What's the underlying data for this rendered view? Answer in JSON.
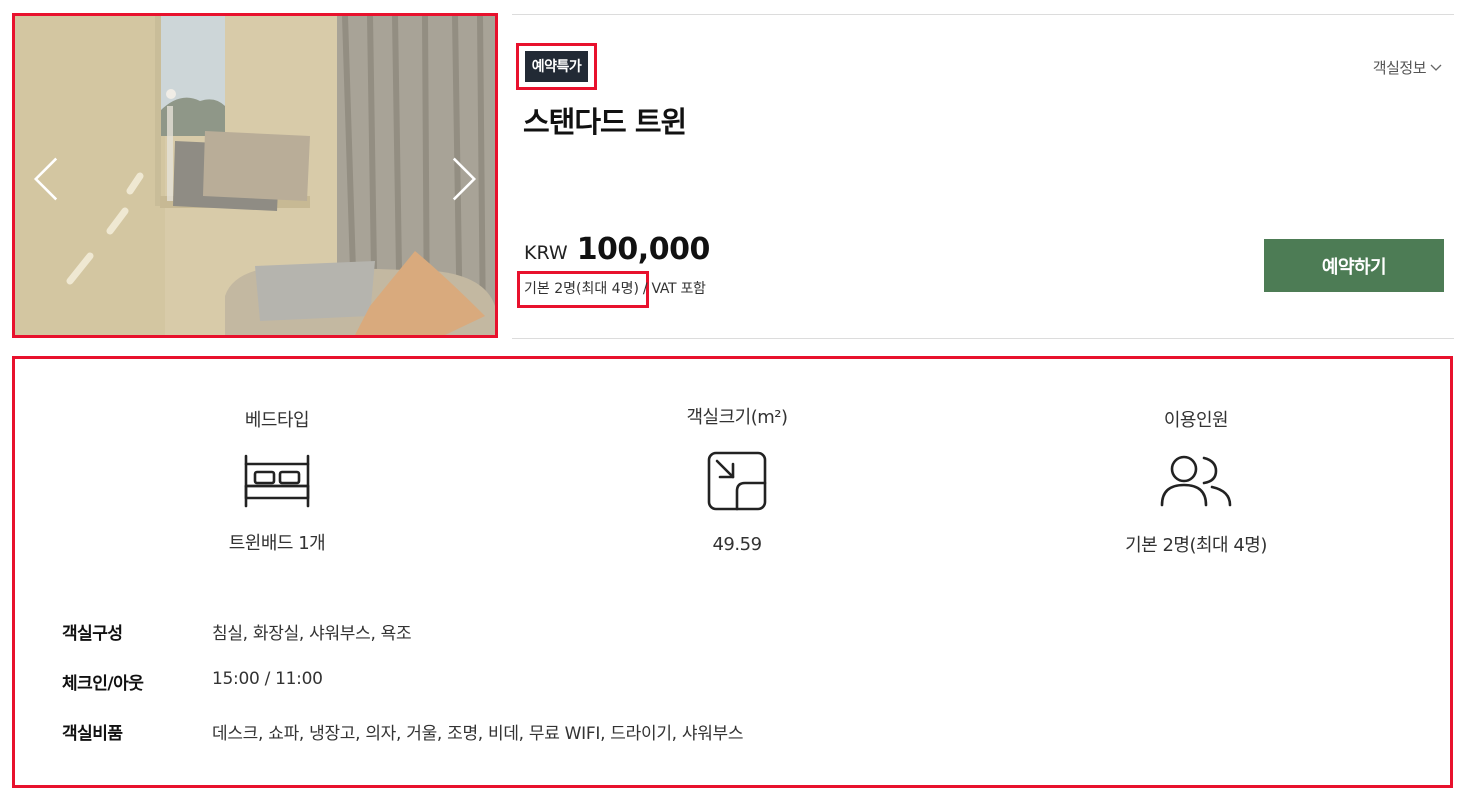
{
  "room": {
    "badge": "예약특가",
    "title": "스탠다드 트윈",
    "info_toggle": "객실정보",
    "currency": "KRW",
    "price": "100,000",
    "occupancy": "기본 2명(최대 4명)",
    "vat": "/ VAT 포함",
    "reserve_label": "예약하기"
  },
  "features": {
    "bed": {
      "label": "베드타입",
      "value": "트윈배드 1개",
      "icon": "bed-icon"
    },
    "size": {
      "label": "객실크기(m²)",
      "value": "49.59",
      "icon": "resize-icon"
    },
    "guests": {
      "label": "이용인원",
      "value": "기본 2명(최대 4명)",
      "icon": "people-icon"
    }
  },
  "specs": [
    {
      "key": "객실구성",
      "value": "침실, 화장실, 샤워부스, 욕조"
    },
    {
      "key": "체크인/아웃",
      "value": "15:00 / 11:00"
    },
    {
      "key": "객실비품",
      "value": "데스크, 쇼파, 냉장고, 의자, 거울, 조명, 비데, 무료 WIFI, 드라이기, 샤워부스"
    }
  ],
  "colors": {
    "highlight": "#e8112d",
    "badge_bg": "#222a35",
    "reserve_bg": "#4d7c55"
  }
}
